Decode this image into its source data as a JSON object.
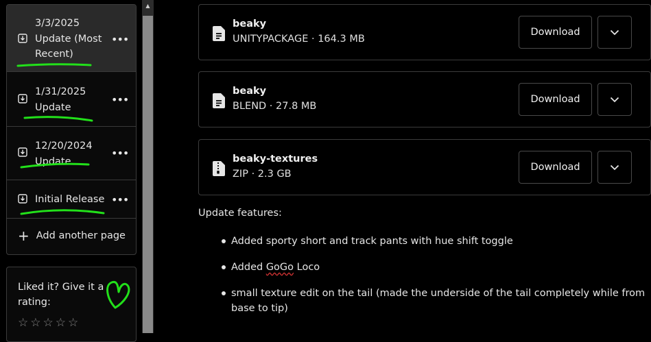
{
  "sidebar": {
    "pages": [
      {
        "label": "3/3/2025 Update (Most Recent)",
        "active": true
      },
      {
        "label": "1/31/2025 Update",
        "active": false
      },
      {
        "label": "12/20/2024 Update",
        "active": false
      },
      {
        "label": "Initial Release",
        "active": false
      }
    ],
    "more_label": "•••",
    "add_page_label": "Add another page"
  },
  "rating": {
    "prompt": "Liked it? Give it a rating:",
    "stars": [
      "☆",
      "☆",
      "☆",
      "☆",
      "☆"
    ]
  },
  "files": [
    {
      "name": "beaky",
      "meta": "UNITYPACKAGE · 164.3 MB",
      "icon": "file-text-icon"
    },
    {
      "name": "beaky",
      "meta": "BLEND · 27.8 MB",
      "icon": "file-text-icon"
    },
    {
      "name": "beaky-textures",
      "meta": "ZIP · 2.3 GB",
      "icon": "file-zip-icon"
    }
  ],
  "download_label": "Download",
  "features": {
    "heading": "Update features:",
    "items": [
      {
        "pre": "Added sporty short and track pants with hue shift toggle",
        "mark": "",
        "post": ""
      },
      {
        "pre": "Added ",
        "mark": "GoGo",
        "post": " Loco"
      },
      {
        "pre": "small texture edit on the tail (made the underside of the tail completely while from base to tip)",
        "mark": "",
        "post": ""
      }
    ]
  },
  "colors": {
    "background": "#000000",
    "active_item": "#2a2a2a",
    "annotation_green": "#22e01a",
    "spellcheck_red": "#c43030"
  }
}
